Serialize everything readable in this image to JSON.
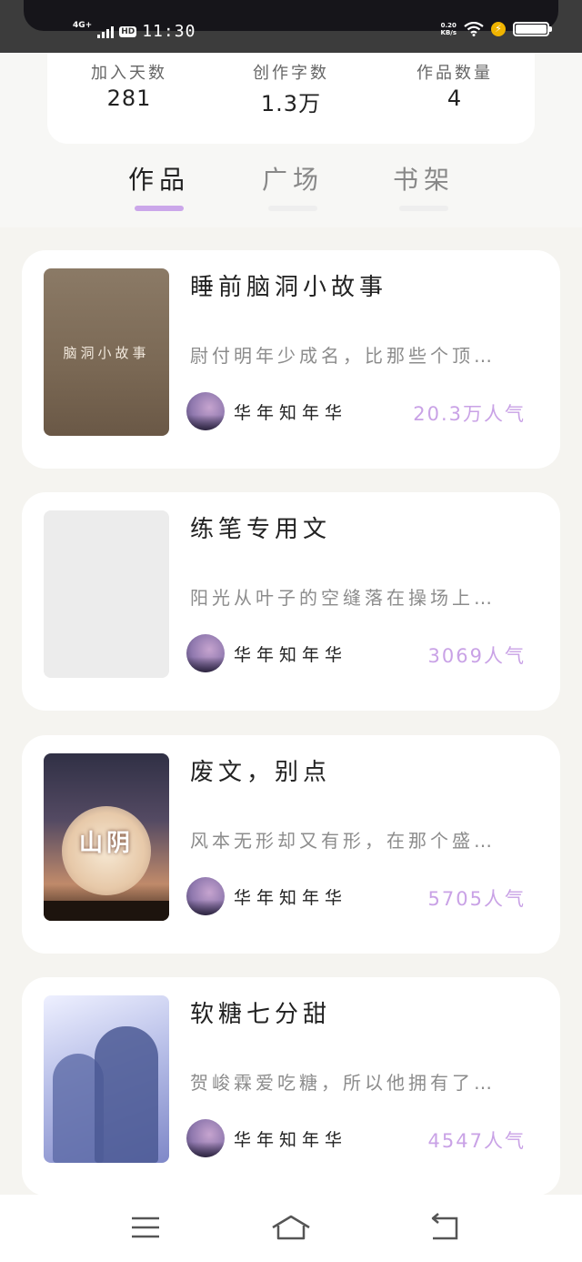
{
  "status_bar": {
    "network": "4G+",
    "hd": "HD",
    "time": "11:30",
    "speed_value": "0.20",
    "speed_unit": "KB/s"
  },
  "stats": [
    {
      "label": "加入天数",
      "value": "281"
    },
    {
      "label": "创作字数",
      "value": "1.3万"
    },
    {
      "label": "作品数量",
      "value": "4"
    }
  ],
  "tabs": [
    {
      "label": "作品",
      "active": true
    },
    {
      "label": "广场",
      "active": false
    },
    {
      "label": "书架",
      "active": false
    }
  ],
  "works": [
    {
      "title": "睡前脑洞小故事",
      "cover_text": "脑洞小故事",
      "excerpt": "尉付明年少成名，比那些个顶…",
      "author": "华年知年华",
      "popularity": "20.3万人气"
    },
    {
      "title": "练笔专用文",
      "cover_text": "",
      "excerpt": "阳光从叶子的空缝落在操场上…",
      "author": "华年知年华",
      "popularity": "3069人气"
    },
    {
      "title": "废文，别点",
      "cover_text": "山阴",
      "excerpt": "风本无形却又有形，在那个盛…",
      "author": "华年知年华",
      "popularity": "5705人气"
    },
    {
      "title": "软糖七分甜",
      "cover_text": "",
      "excerpt": "贺峻霖爱吃糖，所以他拥有了…",
      "author": "华年知年华",
      "popularity": "4547人气"
    }
  ],
  "colors": {
    "accent": "#cba7ea",
    "popularity": "#c9a2e6",
    "background": "#f5f4f0"
  },
  "nav": [
    {
      "icon": "menu-icon"
    },
    {
      "icon": "home-icon"
    },
    {
      "icon": "back-icon"
    }
  ]
}
